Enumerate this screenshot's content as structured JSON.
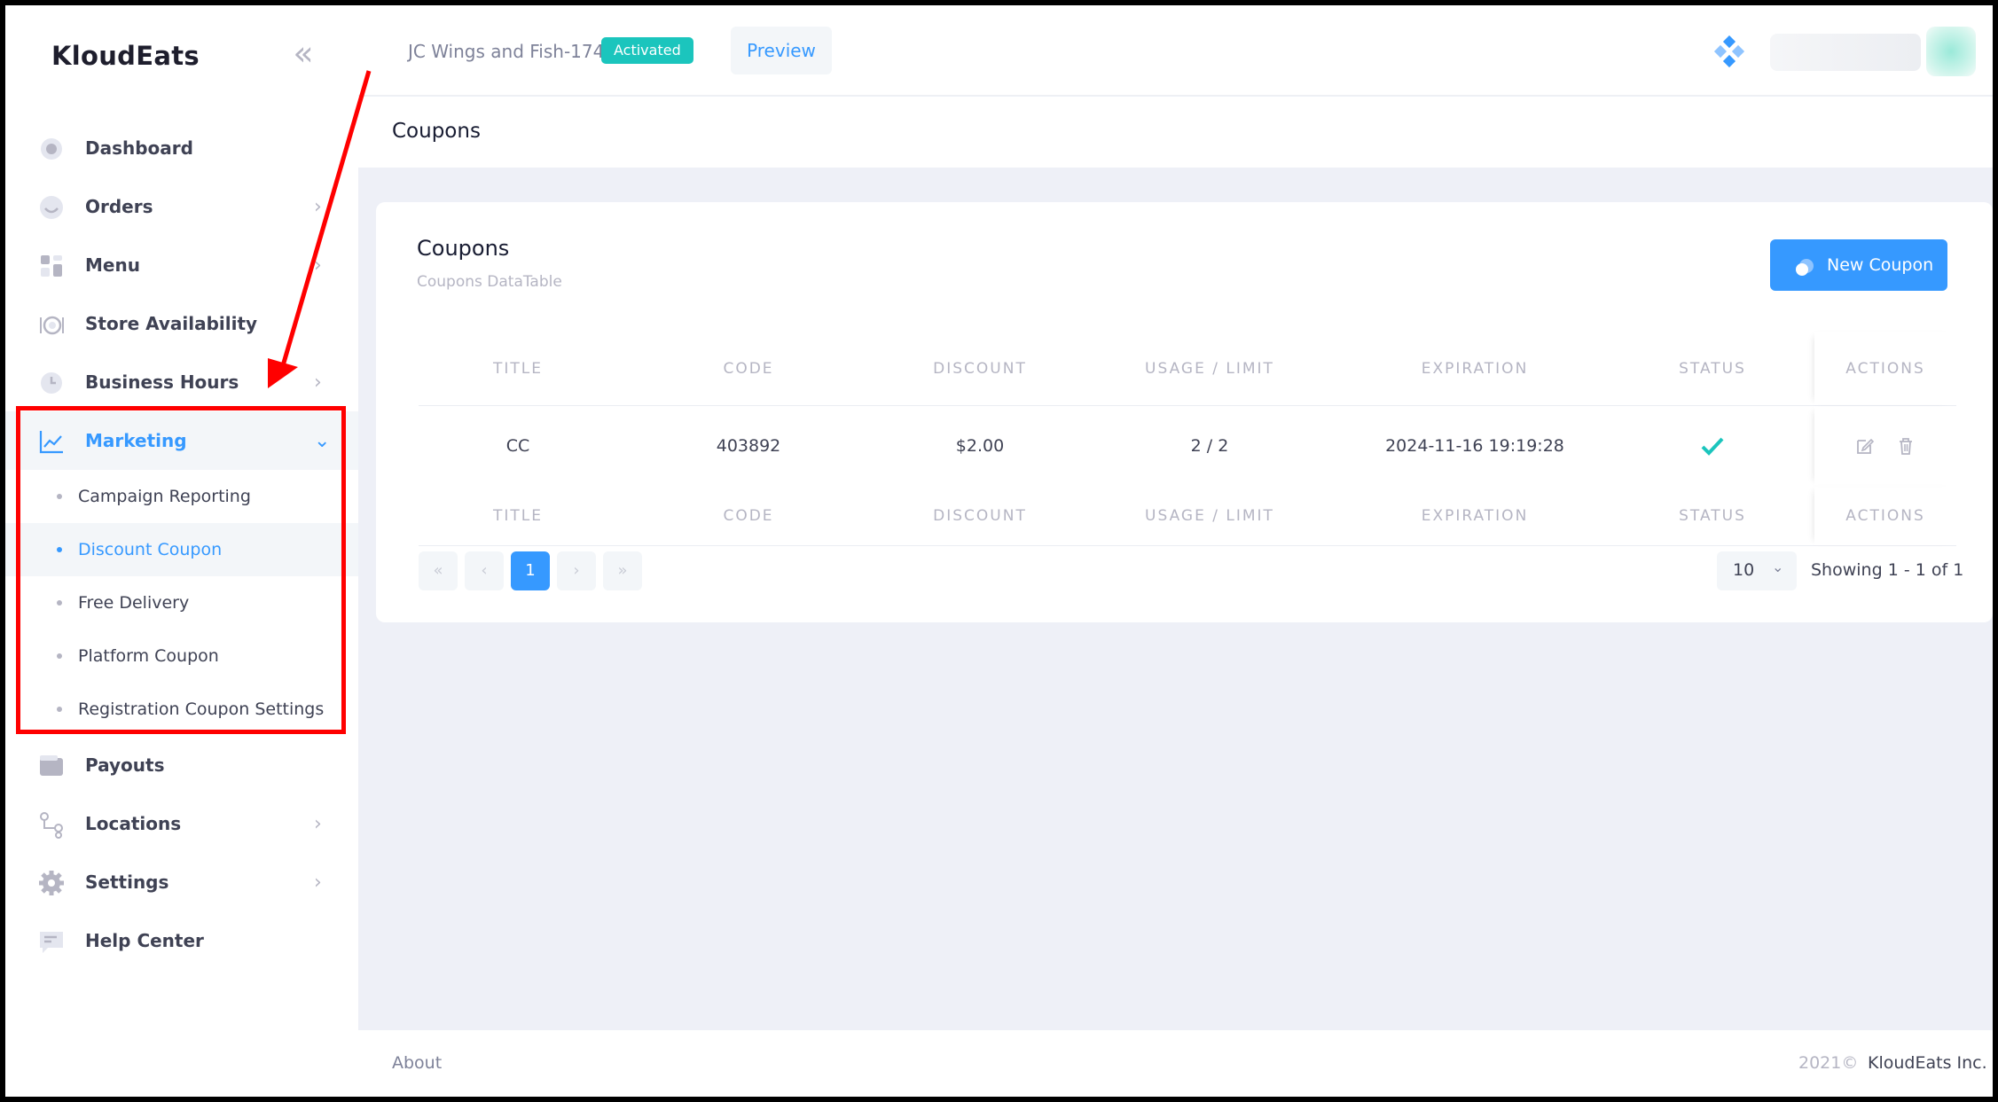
{
  "brand": "KloudEats",
  "header": {
    "store_name": "JC Wings and Fish-174",
    "status": "Activated",
    "preview": "Preview"
  },
  "sidebar": {
    "items": [
      {
        "label": "Dashboard",
        "icon": "dashboard-icon"
      },
      {
        "label": "Orders",
        "icon": "orders-icon"
      },
      {
        "label": "Menu",
        "icon": "menu-icon"
      },
      {
        "label": "Store Availability",
        "icon": "store-availability-icon"
      },
      {
        "label": "Business Hours",
        "icon": "clock-icon"
      },
      {
        "label": "Marketing",
        "icon": "chart-line-icon"
      },
      {
        "label": "Payouts",
        "icon": "wallet-icon"
      },
      {
        "label": "Locations",
        "icon": "locations-icon"
      },
      {
        "label": "Settings",
        "icon": "gear-icon"
      },
      {
        "label": "Help Center",
        "icon": "chat-icon"
      }
    ],
    "marketing_sub": [
      {
        "label": "Campaign Reporting"
      },
      {
        "label": "Discount Coupon"
      },
      {
        "label": "Free Delivery"
      },
      {
        "label": "Platform Coupon"
      },
      {
        "label": "Registration Coupon Settings"
      }
    ]
  },
  "subheader": {
    "title": "Coupons"
  },
  "card": {
    "title": "Coupons",
    "subtitle": "Coupons DataTable",
    "new_button": "New Coupon"
  },
  "table": {
    "columns": [
      "TITLE",
      "CODE",
      "DISCOUNT",
      "USAGE / LIMIT",
      "EXPIRATION",
      "STATUS",
      "ACTIONS"
    ],
    "rows": [
      {
        "title": "CC",
        "code": "403892",
        "discount": "$2.00",
        "usage": "2 / 2",
        "expiration": "2024-11-16 19:19:28",
        "status": "active"
      }
    ]
  },
  "pagination": {
    "first": "«",
    "prev": "‹",
    "current": "1",
    "next": "›",
    "last": "»",
    "per_page": "10",
    "showing": "Showing 1 - 1 of 1"
  },
  "footer": {
    "about": "About",
    "year": "2021©",
    "company": "KloudEats Inc."
  },
  "colors": {
    "accent": "#3699ff",
    "success": "#1bc5bd",
    "annotation": "#ff0000"
  }
}
